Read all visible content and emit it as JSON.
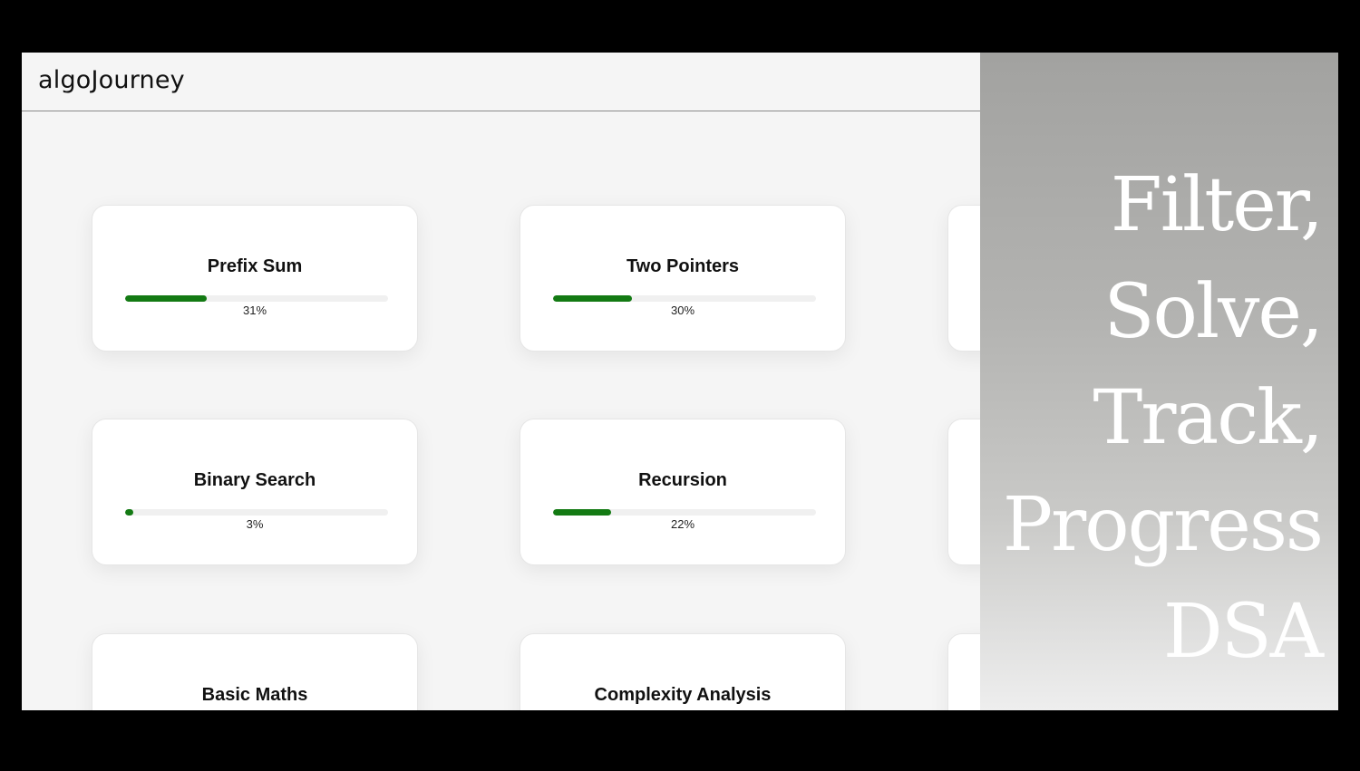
{
  "app": {
    "logo": "algoJourney"
  },
  "topics": [
    {
      "title": "Prefix Sum",
      "progress_label": "31%",
      "progress": 0.31
    },
    {
      "title": "Two Pointers",
      "progress_label": "30%",
      "progress": 0.3
    },
    {
      "title": "Binary Search",
      "progress_label": "3%",
      "progress": 0.03
    },
    {
      "title": "Recursion",
      "progress_label": "22%",
      "progress": 0.22
    },
    {
      "title": "Basic Maths",
      "progress_label": "",
      "progress": null
    },
    {
      "title": "Complexity Analysis",
      "progress_label": "",
      "progress": null
    }
  ],
  "promo": {
    "lines": [
      "Filter,",
      "Solve,",
      "Track,",
      "Progress",
      "DSA"
    ]
  },
  "colors": {
    "progress_fill": "#137a13",
    "progress_track": "#f0f0f0"
  }
}
